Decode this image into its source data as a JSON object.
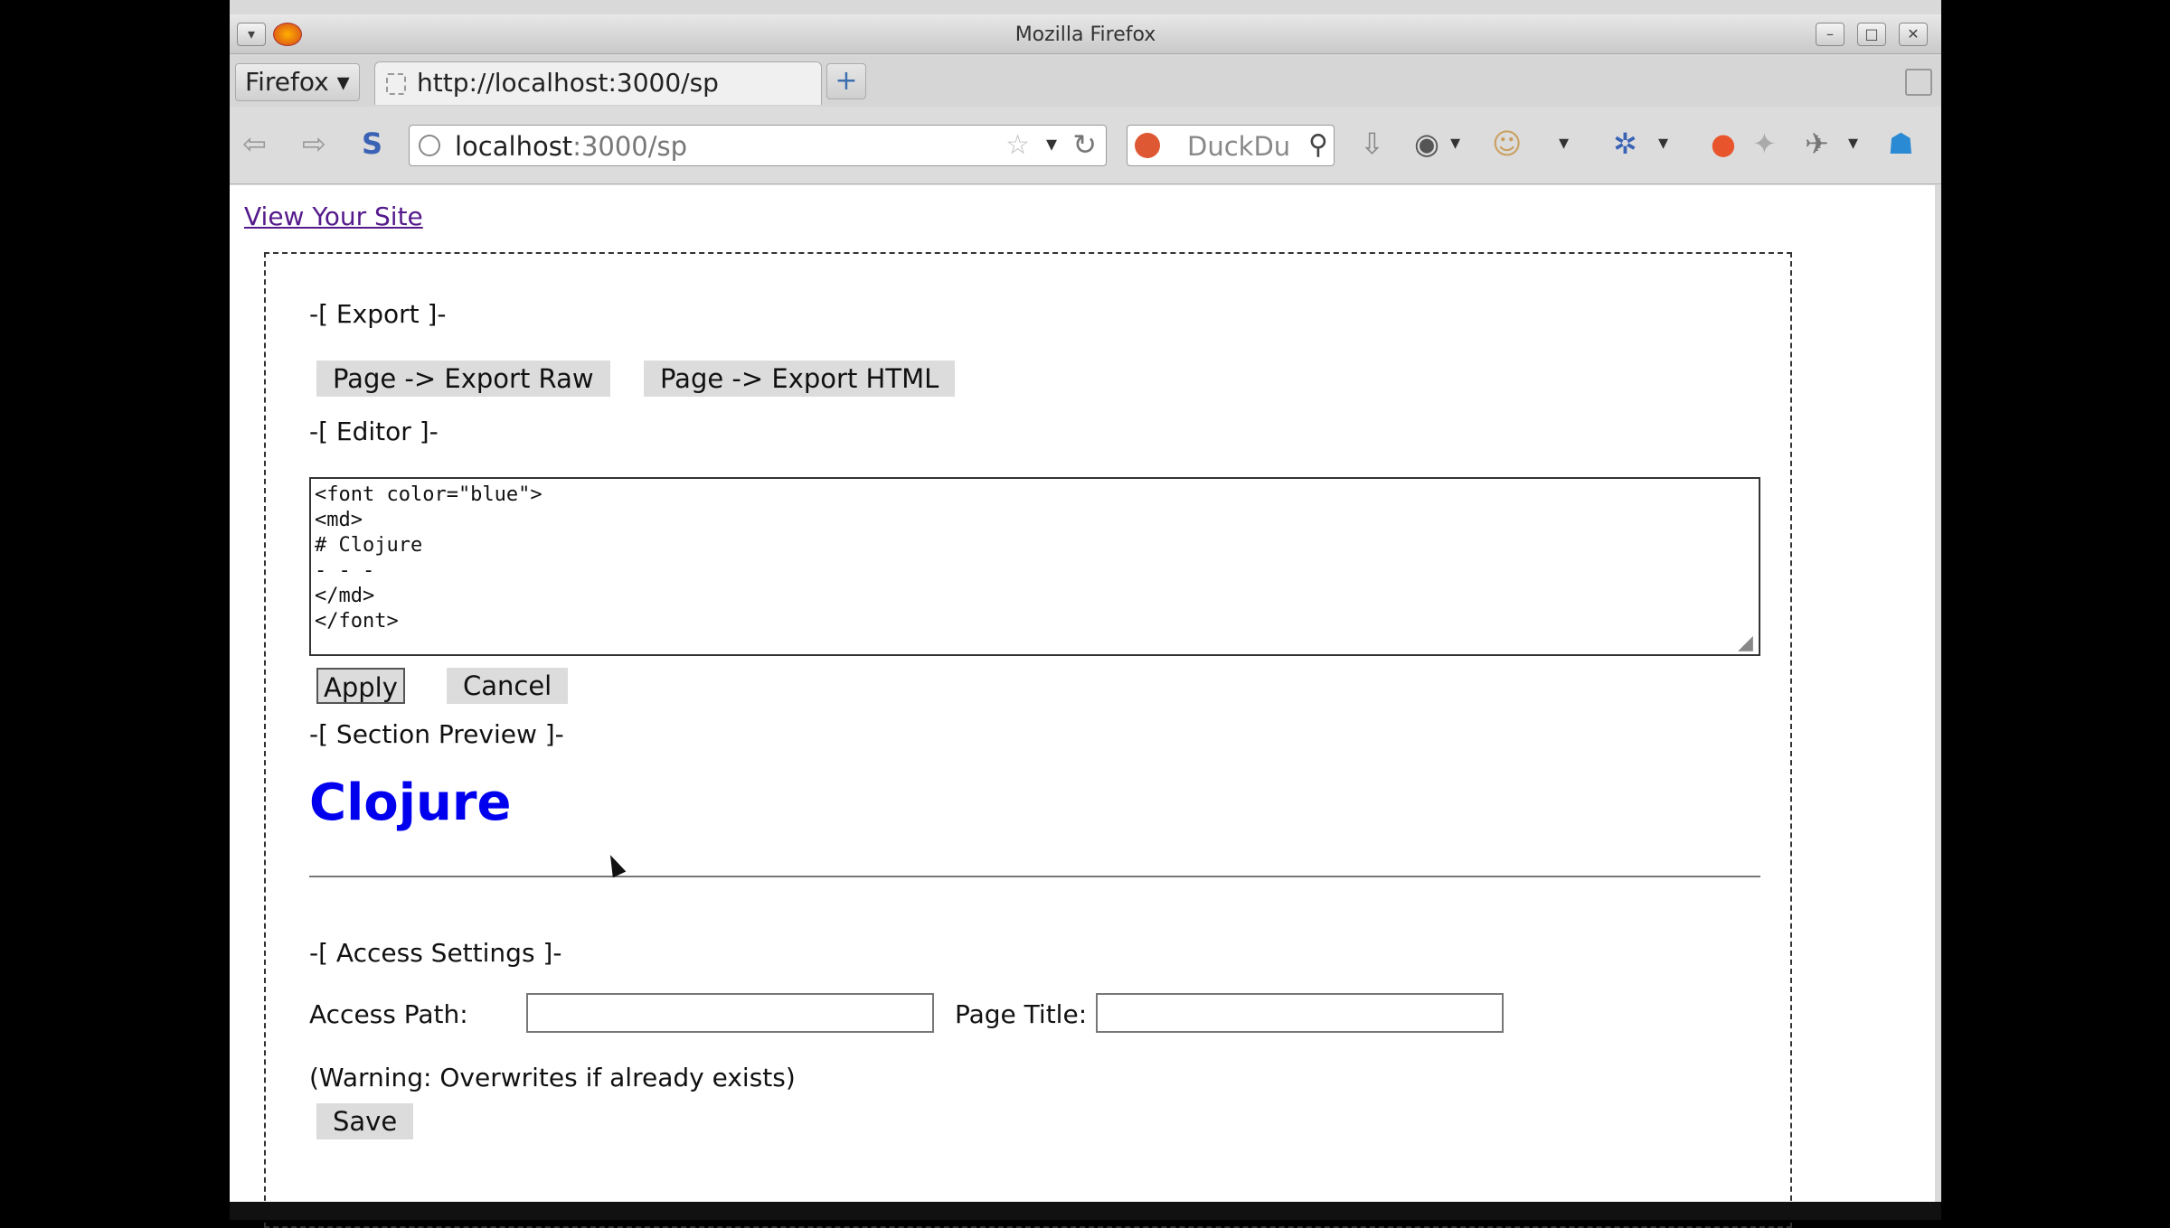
{
  "window": {
    "title": "Mozilla Firefox",
    "buttons": {
      "minimize": "–",
      "maximize": "□",
      "close": "✕"
    }
  },
  "tabbar": {
    "menu_label": "Firefox ▾",
    "tab_title": "http://localhost:3000/sp",
    "new_tab": "+"
  },
  "navbar": {
    "url_host": "localhost",
    "url_path": ":3000/sp",
    "search_placeholder": "DuckDu"
  },
  "page": {
    "view_site_link": "View Your Site",
    "export_label": "-[ Export ]-",
    "export_raw_button": "Page -> Export Raw",
    "export_html_button": "Page -> Export HTML",
    "editor_label": "-[ Editor ]-",
    "editor_content": "<font color=\"blue\">\n<md>\n# Clojure\n- - -\n</md>\n</font>",
    "apply_button": "Apply",
    "cancel_button": "Cancel",
    "preview_label": "-[ Section Preview ]-",
    "preview_heading": "Clojure",
    "access_label": "-[ Access Settings ]-",
    "access_path_label": "Access Path:",
    "access_path_value": "",
    "page_title_label": "Page Title:",
    "page_title_value": "",
    "warning_text": "(Warning: Overwrites if already exists)",
    "save_button": "Save"
  },
  "colors": {
    "link": "#551a8b",
    "preview_heading": "#0000ee"
  }
}
